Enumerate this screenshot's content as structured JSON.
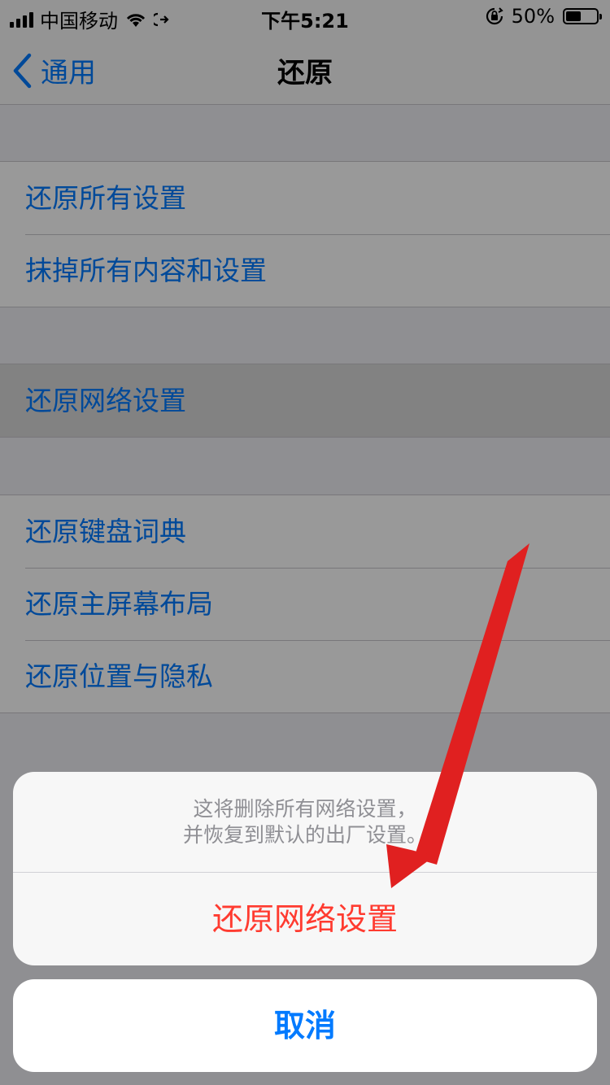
{
  "status_bar": {
    "carrier": "中国移动",
    "time": "下午5:21",
    "battery_percent": "50%",
    "battery_level": 0.5,
    "icons": [
      "signal-icon",
      "wifi-icon",
      "call-forward-icon",
      "orientation-lock-icon",
      "battery-icon"
    ]
  },
  "nav": {
    "back_label": "通用",
    "title": "还原"
  },
  "groups": [
    {
      "items": [
        {
          "label": "还原所有设置"
        },
        {
          "label": "抹掉所有内容和设置"
        }
      ]
    },
    {
      "items": [
        {
          "label": "还原网络设置",
          "highlighted": true
        }
      ]
    },
    {
      "items": [
        {
          "label": "还原键盘词典"
        },
        {
          "label": "还原主屏幕布局"
        },
        {
          "label": "还原位置与隐私"
        }
      ]
    }
  ],
  "action_sheet": {
    "message_line1": "这将删除所有网络设置，",
    "message_line2": "并恢复到默认的出厂设置。",
    "destructive_label": "还原网络设置",
    "cancel_label": "取消"
  },
  "colors": {
    "accent": "#007aff",
    "destructive": "#ff3b30",
    "annotation_arrow": "#e02020"
  }
}
